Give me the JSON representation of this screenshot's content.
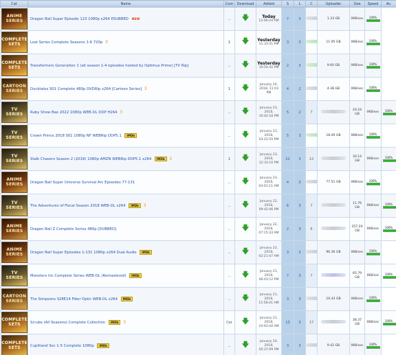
{
  "columns": {
    "cat": "Cat",
    "name": "Name",
    "com": "Com",
    "download": "Download",
    "added": "Added",
    "s": "S",
    "l": "L",
    "c": "C",
    "uploader": "Uploader",
    "size": "Size",
    "speed": "Speed",
    "av": "Av."
  },
  "colors": {
    "link": "#2250a8",
    "header_text": "#1a3d6d",
    "seed_bg": "#b9d2ea",
    "bar_fill": "#23b823",
    "badge_yellow": "#f1d14a"
  },
  "icons": {
    "download": "green-down-arrow-icon",
    "flame": "flame-icon"
  },
  "rows": [
    {
      "cat_style": "anime",
      "cat_lines": [
        "ANIME",
        "SERIES"
      ],
      "name": "Dragon Ball Super Episode 123 1080p x264 ESUBBED",
      "new": "NEW",
      "imdb": "",
      "flame": "",
      "comments": "...",
      "added_line1": "Today",
      "added_line2": "12:06:24 AM",
      "added_big": true,
      "seeders": "7",
      "leechers": "3",
      "completed": "",
      "uploader_tint": "grey",
      "size": "1.33 GB",
      "speed": "0KB/sec",
      "avail": 100
    },
    {
      "cat_style": "complete",
      "cat_lines": [
        "COMPLETE",
        "SETS"
      ],
      "name": "Lost Series Complete Seasons 1-6 720p",
      "new": "",
      "imdb": "",
      "flame": "3",
      "comments": "1",
      "added_line1": "Yesterday",
      "added_line2": "11:33:51 PM",
      "added_big": true,
      "seeders": "3",
      "leechers": "3",
      "completed": "",
      "uploader_tint": "green",
      "size": "11.95 GB",
      "speed": "0KB/sec",
      "avail": 100
    },
    {
      "cat_style": "complete",
      "cat_lines": [
        "COMPLETE",
        "SETS"
      ],
      "name": "Transformers Generation 1 (all season 1-4 episodes hosted by Optimus Prime) [TV Rip]",
      "new": "",
      "imdb": "",
      "flame": "",
      "comments": "...",
      "added_line1": "Yesterday",
      "added_line2": "10:54:42 PM",
      "added_big": true,
      "seeders": "2",
      "leechers": "3",
      "completed": "",
      "uploader_tint": "green",
      "size": "9.60 GB",
      "speed": "0KB/sec",
      "avail": 100
    },
    {
      "cat_style": "cartoon",
      "cat_lines": [
        "CARTOON",
        "SERIES"
      ],
      "name": "Ducktales S01 Complete 480p DVDRip x264 [Cartoon Series]",
      "new": "",
      "imdb": "",
      "flame": "3",
      "comments": "1",
      "added_line1": "January 24,",
      "added_line2": "2018, 11:03 PM",
      "added_big": false,
      "seeders": "4",
      "leechers": "2",
      "completed": "",
      "uploader_tint": "grey",
      "size": "4.38 GB",
      "speed": "0KB/sec",
      "avail": 100
    },
    {
      "cat_style": "tv",
      "cat_lines": [
        "TV",
        "SERIES"
      ],
      "name": "Ruby Show Bae 2022 1080p WEB-DL DDP H264",
      "new": "",
      "imdb": "",
      "flame": "3",
      "comments": "...",
      "added_line1": "January 23,",
      "added_line2": "2018, 10:02:18 PM",
      "added_big": false,
      "seeders": "5",
      "leechers": "2",
      "completed": "7",
      "uploader_tint": "grey",
      "size": "20.24 GB",
      "speed": "0KB/sec",
      "avail": 100
    },
    {
      "cat_style": "tv",
      "cat_lines": [
        "TV",
        "SERIES"
      ],
      "name": "Crown Prince 2018 S01 1080p NF WEBRip DDP5.1",
      "new": "",
      "imdb": "IMDb",
      "flame": "",
      "comments": "...",
      "added_line1": "January 23,",
      "added_line2": "2018, 03:22:55 PM",
      "added_big": false,
      "seeders": "5",
      "leechers": "3",
      "completed": "",
      "uploader_tint": "green",
      "size": "18.49 GB",
      "speed": "0KB/sec",
      "avail": 100
    },
    {
      "cat_style": "tv",
      "cat_lines": [
        "TV",
        "SERIES"
      ],
      "name": "Stalk Chasers Season 2 (2018) 1080p AMZN WEBRip DDP5.1 x264",
      "new": "",
      "imdb": "IMDb",
      "flame": "3",
      "comments": "1",
      "added_line1": "January 23,",
      "added_line2": "2018, 12:33:10 PM",
      "added_big": false,
      "seeders": "11",
      "leechers": "3",
      "completed": "12",
      "uploader_tint": "grey",
      "size": "30.14 GB",
      "speed": "0KB/sec",
      "avail": 100
    },
    {
      "cat_style": "anime",
      "cat_lines": [
        "ANIME",
        "SERIES"
      ],
      "name": "Dragon Ball Super Universe Survival Arc Episodes 77-131",
      "new": "",
      "imdb": "",
      "flame": "",
      "comments": "...",
      "added_line1": "January 23,",
      "added_line2": "2018, 04:01:11 AM",
      "added_big": false,
      "seeders": "4",
      "leechers": "3",
      "completed": "",
      "uploader_tint": "grey",
      "size": "77.51 GB",
      "speed": "0KB/sec",
      "avail": 100
    },
    {
      "cat_style": "tv",
      "cat_lines": [
        "TV",
        "SERIES"
      ],
      "name": "The Adventures of Fiscal Season 2018 WEB-DL x264",
      "new": "",
      "imdb": "IMDb",
      "flame": "3",
      "comments": "...",
      "added_line1": "January 22,",
      "added_line2": "2018, 09:42:06 PM",
      "added_big": false,
      "seeders": "6",
      "leechers": "3",
      "completed": "7",
      "uploader_tint": "grey",
      "size": "11.76 GB",
      "speed": "0KB/sec",
      "avail": 100
    },
    {
      "cat_style": "anime",
      "cat_lines": [
        "ANIME",
        "SERIES"
      ],
      "name": "Dragon Ball Z Complete Series 480p [DUBBED]",
      "new": "",
      "imdb": "",
      "flame": "",
      "comments": "...",
      "added_line1": "January 22,",
      "added_line2": "2018, 07:15:33 AM",
      "added_big": false,
      "seeders": "2",
      "leechers": "3",
      "completed": "6",
      "uploader_tint": "grey",
      "size": "257.20 GB",
      "speed": "0KB/sec",
      "avail": 100
    },
    {
      "cat_style": "anime",
      "cat_lines": [
        "ANIME",
        "SERIES"
      ],
      "name": "Dragon Ball Super Episodes 1-131 1080p x264 Dual Audio",
      "new": "",
      "imdb": "IMDb",
      "flame": "",
      "comments": "...",
      "added_line1": "January 22,",
      "added_line2": "2018, 02:21:47 AM",
      "added_big": false,
      "seeders": "3",
      "leechers": "3",
      "completed": "",
      "uploader_tint": "grey",
      "size": "96.36 GB",
      "speed": "0KB/sec",
      "avail": 100
    },
    {
      "cat_style": "tv",
      "cat_lines": [
        "TV",
        "SERIES"
      ],
      "name": "Monsters Inc Complete Series WEB-DL (Remastered)",
      "new": "",
      "imdb": "IMDb",
      "flame": "",
      "comments": "...",
      "added_line1": "January 21,",
      "added_line2": "2018, 06:03:12 PM",
      "added_big": false,
      "seeders": "7",
      "leechers": "3",
      "completed": "7",
      "uploader_tint": "blue",
      "size": "65.79 GB",
      "speed": "0KB/sec",
      "avail": 100
    },
    {
      "cat_style": "cartoon",
      "cat_lines": [
        "CARTOON",
        "SERIES"
      ],
      "name": "The Simpsons S28E14 Fiber Optic WEB-DL x264",
      "new": "",
      "imdb": "IMDb",
      "flame": "",
      "comments": "...",
      "added_line1": "January 21,",
      "added_line2": "2018, 11:58:41 AM",
      "added_big": false,
      "seeders": "3",
      "leechers": "3",
      "completed": "",
      "uploader_tint": "grey",
      "size": "10.43 GB",
      "speed": "0KB/sec",
      "avail": 100
    },
    {
      "cat_style": "complete",
      "cat_lines": [
        "COMPLETE",
        "SETS"
      ],
      "name": "Scrubs (All Seasons) Complete Collection",
      "new": "",
      "imdb": "IMDb",
      "flame": "3",
      "comments": "Cor",
      "added_line1": "January 21,",
      "added_line2": "2018, 10:02:44 AM",
      "added_big": false,
      "seeders": "13",
      "leechers": "3",
      "completed": "17",
      "uploader_tint": "grey",
      "size": "38.37 GB",
      "speed": "0KB/sec",
      "avail": 100
    },
    {
      "cat_style": "complete",
      "cat_lines": [
        "COMPLETE",
        "SETS"
      ],
      "name": "Cupitland Sec 1-5 Complete 1080p",
      "new": "",
      "imdb": "IMDb",
      "flame": "",
      "comments": "...",
      "added_line1": "January 20,",
      "added_line2": "2018, 05:27:09 PM",
      "added_big": false,
      "seeders": "3",
      "leechers": "3",
      "completed": "",
      "uploader_tint": "grey",
      "size": "9.42 GB",
      "speed": "0KB/sec",
      "avail": 100
    }
  ]
}
